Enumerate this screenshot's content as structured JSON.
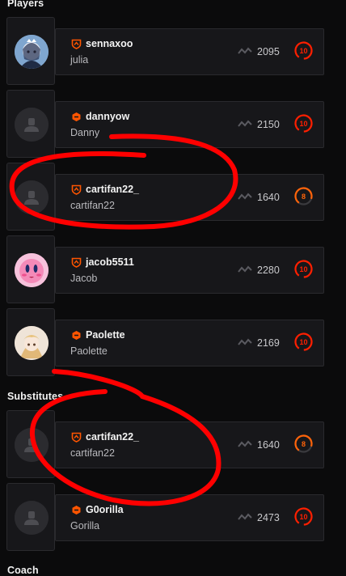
{
  "sections": {
    "players": "Players",
    "substitutes": "Substitutes",
    "coach": "Coach"
  },
  "players": [
    {
      "nickname": "sennaxoo",
      "name": "julia",
      "elo": "2095",
      "level": "10",
      "avatar": "anime-avatar-icon",
      "shield": "shield-icon"
    },
    {
      "nickname": "dannyow",
      "name": "Danny",
      "elo": "2150",
      "level": "10",
      "avatar": "default-user-icon",
      "shield": "hexagon-icon"
    },
    {
      "nickname": "cartifan22_",
      "name": "cartifan22",
      "elo": "1640",
      "level": "8",
      "avatar": "default-user-icon",
      "shield": "shield-icon"
    },
    {
      "nickname": "jacob5511",
      "name": "Jacob",
      "elo": "2280",
      "level": "10",
      "avatar": "pink-avatar-icon",
      "shield": "shield-icon"
    },
    {
      "nickname": "Paolette",
      "name": "Paolette",
      "elo": "2169",
      "level": "10",
      "avatar": "anime-avatar-icon",
      "shield": "hexagon-icon"
    }
  ],
  "substitutes": [
    {
      "nickname": "cartifan22_",
      "name": "cartifan22",
      "elo": "1640",
      "level": "8",
      "avatar": "default-user-icon",
      "shield": "shield-icon"
    },
    {
      "nickname": "G0orilla",
      "name": "Gorilla",
      "elo": "2473",
      "level": "10",
      "avatar": "default-user-icon",
      "shield": "hexagon-icon"
    }
  ],
  "colors": {
    "accent": "#ff5500",
    "level10": "#fe1f00",
    "level8": "#ff6309",
    "annotation": "#ff0000"
  }
}
